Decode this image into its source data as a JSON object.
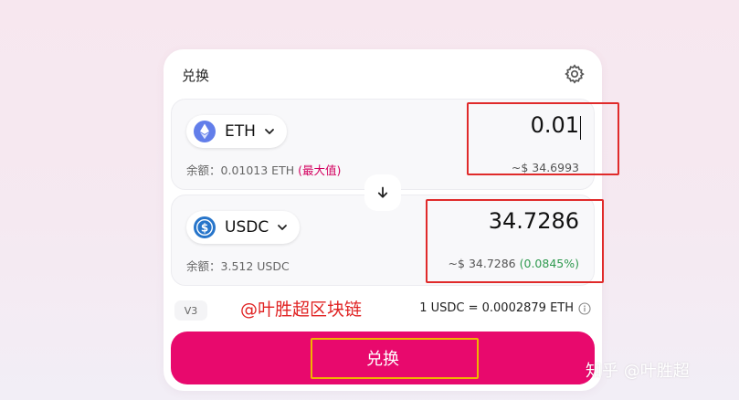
{
  "card": {
    "title": "兑换"
  },
  "from": {
    "token": "ETH",
    "amount": "0.01",
    "balance_label": "余额：",
    "balance_value": "0.01013 ETH",
    "max_label": "(最大值)",
    "usd": "~$ 34.6993"
  },
  "to": {
    "token": "USDC",
    "amount": "34.7286",
    "balance_label": "余额：",
    "balance_value": "3.512 USDC",
    "usd": "~$ 34.7286",
    "pct": "(0.0845%)"
  },
  "route": {
    "version": "V3"
  },
  "rate": {
    "text": "1 USDC = 0.0002879 ETH"
  },
  "swap_button": {
    "label": "兑换"
  },
  "watermark": "@叶胜超区块链",
  "zhihu": "知乎 @叶胜超",
  "colors": {
    "accent": "#e8096d",
    "annotation_red": "#e02a2a",
    "annotation_yellow": "#f0b400",
    "positive": "#2f9a4f"
  },
  "icons": {
    "settings": "gear-icon",
    "from_token": "eth-logo-icon",
    "to_token": "usdc-logo-icon",
    "switch": "arrow-down-icon",
    "rate_info": "info-icon"
  }
}
